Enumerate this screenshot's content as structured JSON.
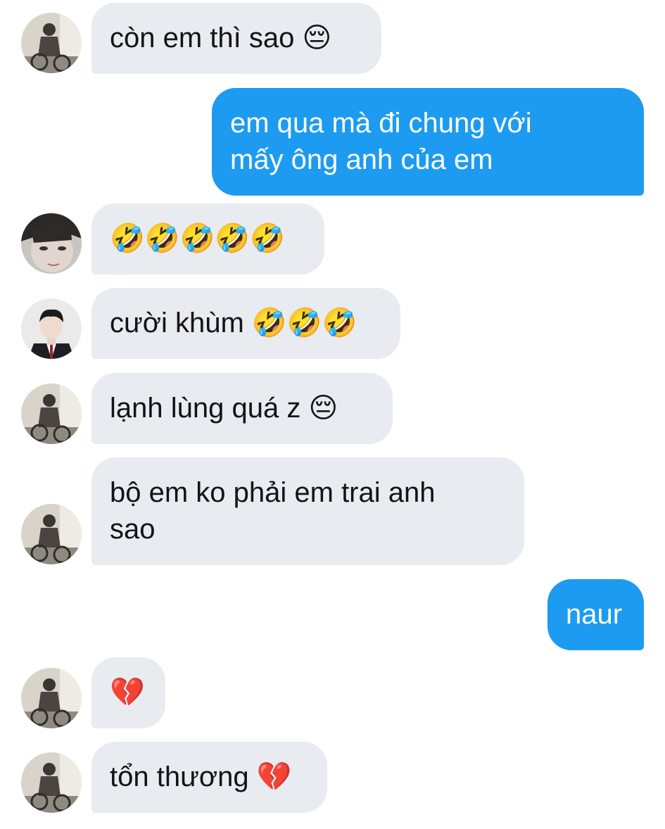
{
  "messages": [
    {
      "direction": "incoming",
      "avatar": "biker-photo",
      "text": "còn em thì sao 😔"
    },
    {
      "direction": "outgoing",
      "text": "em qua mà đi chung với\nmấy ông anh của em"
    },
    {
      "direction": "incoming",
      "avatar": "face-closeup-photo",
      "text": "🤣🤣🤣🤣🤣"
    },
    {
      "direction": "incoming",
      "avatar": "school-uniform-photo",
      "text": "cười khùm 🤣🤣🤣"
    },
    {
      "direction": "incoming",
      "avatar": "biker-photo",
      "text": "lạnh lùng quá z 😔"
    },
    {
      "direction": "incoming",
      "avatar": "biker-photo",
      "text": "bộ em ko phải em trai anh\nsao"
    },
    {
      "direction": "outgoing",
      "text": "naur"
    },
    {
      "direction": "incoming",
      "avatar": "biker-photo",
      "text": "💔"
    },
    {
      "direction": "incoming",
      "avatar": "biker-photo",
      "text": "tổn thương 💔"
    }
  ],
  "colors": {
    "incoming_bubble": "#e8ebef",
    "outgoing_bubble": "#1d9bf0",
    "incoming_text": "#111418",
    "outgoing_text": "#ffffff"
  }
}
